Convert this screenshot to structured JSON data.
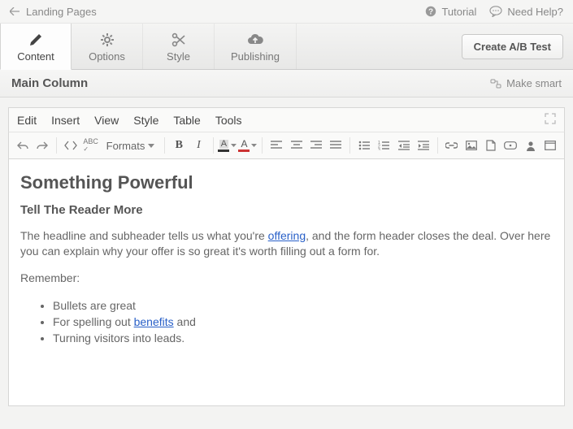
{
  "topbar": {
    "back_label": "Landing Pages",
    "tutorial_label": "Tutorial",
    "help_label": "Need Help?"
  },
  "tabs": {
    "content": "Content",
    "options": "Options",
    "style": "Style",
    "publishing": "Publishing",
    "create_ab": "Create A/B Test"
  },
  "section": {
    "title": "Main Column",
    "make_smart": "Make smart"
  },
  "menu": {
    "edit": "Edit",
    "insert": "Insert",
    "view": "View",
    "style": "Style",
    "table": "Table",
    "tools": "Tools"
  },
  "toolbar": {
    "formats": "Formats"
  },
  "doc": {
    "h1": "Something Powerful",
    "h2": "Tell The Reader More",
    "p1a": "The headline and subheader tells us what you're ",
    "p1_link": "offering",
    "p1b": ", and the form header closes the deal. Over here you can explain why your offer is so great it's worth filling out a form for.",
    "p2": "Remember:",
    "li1": "Bullets are great",
    "li2a": "For spelling out ",
    "li2_link": "benefits",
    "li2b": " and",
    "li3": "Turning visitors into leads."
  }
}
